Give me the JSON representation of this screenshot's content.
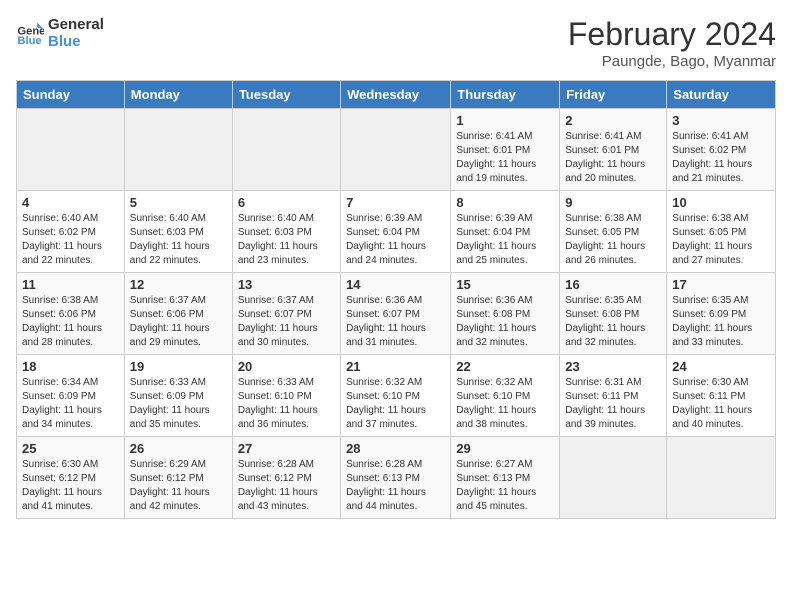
{
  "logo": {
    "line1": "General",
    "line2": "Blue"
  },
  "title": "February 2024",
  "subtitle": "Paungde, Bago, Myanmar",
  "days_of_week": [
    "Sunday",
    "Monday",
    "Tuesday",
    "Wednesday",
    "Thursday",
    "Friday",
    "Saturday"
  ],
  "weeks": [
    [
      {
        "day": "",
        "info": ""
      },
      {
        "day": "",
        "info": ""
      },
      {
        "day": "",
        "info": ""
      },
      {
        "day": "",
        "info": ""
      },
      {
        "day": "1",
        "info": "Sunrise: 6:41 AM\nSunset: 6:01 PM\nDaylight: 11 hours and 19 minutes."
      },
      {
        "day": "2",
        "info": "Sunrise: 6:41 AM\nSunset: 6:01 PM\nDaylight: 11 hours and 20 minutes."
      },
      {
        "day": "3",
        "info": "Sunrise: 6:41 AM\nSunset: 6:02 PM\nDaylight: 11 hours and 21 minutes."
      }
    ],
    [
      {
        "day": "4",
        "info": "Sunrise: 6:40 AM\nSunset: 6:02 PM\nDaylight: 11 hours and 22 minutes."
      },
      {
        "day": "5",
        "info": "Sunrise: 6:40 AM\nSunset: 6:03 PM\nDaylight: 11 hours and 22 minutes."
      },
      {
        "day": "6",
        "info": "Sunrise: 6:40 AM\nSunset: 6:03 PM\nDaylight: 11 hours and 23 minutes."
      },
      {
        "day": "7",
        "info": "Sunrise: 6:39 AM\nSunset: 6:04 PM\nDaylight: 11 hours and 24 minutes."
      },
      {
        "day": "8",
        "info": "Sunrise: 6:39 AM\nSunset: 6:04 PM\nDaylight: 11 hours and 25 minutes."
      },
      {
        "day": "9",
        "info": "Sunrise: 6:38 AM\nSunset: 6:05 PM\nDaylight: 11 hours and 26 minutes."
      },
      {
        "day": "10",
        "info": "Sunrise: 6:38 AM\nSunset: 6:05 PM\nDaylight: 11 hours and 27 minutes."
      }
    ],
    [
      {
        "day": "11",
        "info": "Sunrise: 6:38 AM\nSunset: 6:06 PM\nDaylight: 11 hours and 28 minutes."
      },
      {
        "day": "12",
        "info": "Sunrise: 6:37 AM\nSunset: 6:06 PM\nDaylight: 11 hours and 29 minutes."
      },
      {
        "day": "13",
        "info": "Sunrise: 6:37 AM\nSunset: 6:07 PM\nDaylight: 11 hours and 30 minutes."
      },
      {
        "day": "14",
        "info": "Sunrise: 6:36 AM\nSunset: 6:07 PM\nDaylight: 11 hours and 31 minutes."
      },
      {
        "day": "15",
        "info": "Sunrise: 6:36 AM\nSunset: 6:08 PM\nDaylight: 11 hours and 32 minutes."
      },
      {
        "day": "16",
        "info": "Sunrise: 6:35 AM\nSunset: 6:08 PM\nDaylight: 11 hours and 32 minutes."
      },
      {
        "day": "17",
        "info": "Sunrise: 6:35 AM\nSunset: 6:09 PM\nDaylight: 11 hours and 33 minutes."
      }
    ],
    [
      {
        "day": "18",
        "info": "Sunrise: 6:34 AM\nSunset: 6:09 PM\nDaylight: 11 hours and 34 minutes."
      },
      {
        "day": "19",
        "info": "Sunrise: 6:33 AM\nSunset: 6:09 PM\nDaylight: 11 hours and 35 minutes."
      },
      {
        "day": "20",
        "info": "Sunrise: 6:33 AM\nSunset: 6:10 PM\nDaylight: 11 hours and 36 minutes."
      },
      {
        "day": "21",
        "info": "Sunrise: 6:32 AM\nSunset: 6:10 PM\nDaylight: 11 hours and 37 minutes."
      },
      {
        "day": "22",
        "info": "Sunrise: 6:32 AM\nSunset: 6:10 PM\nDaylight: 11 hours and 38 minutes."
      },
      {
        "day": "23",
        "info": "Sunrise: 6:31 AM\nSunset: 6:11 PM\nDaylight: 11 hours and 39 minutes."
      },
      {
        "day": "24",
        "info": "Sunrise: 6:30 AM\nSunset: 6:11 PM\nDaylight: 11 hours and 40 minutes."
      }
    ],
    [
      {
        "day": "25",
        "info": "Sunrise: 6:30 AM\nSunset: 6:12 PM\nDaylight: 11 hours and 41 minutes."
      },
      {
        "day": "26",
        "info": "Sunrise: 6:29 AM\nSunset: 6:12 PM\nDaylight: 11 hours and 42 minutes."
      },
      {
        "day": "27",
        "info": "Sunrise: 6:28 AM\nSunset: 6:12 PM\nDaylight: 11 hours and 43 minutes."
      },
      {
        "day": "28",
        "info": "Sunrise: 6:28 AM\nSunset: 6:13 PM\nDaylight: 11 hours and 44 minutes."
      },
      {
        "day": "29",
        "info": "Sunrise: 6:27 AM\nSunset: 6:13 PM\nDaylight: 11 hours and 45 minutes."
      },
      {
        "day": "",
        "info": ""
      },
      {
        "day": "",
        "info": ""
      }
    ]
  ]
}
